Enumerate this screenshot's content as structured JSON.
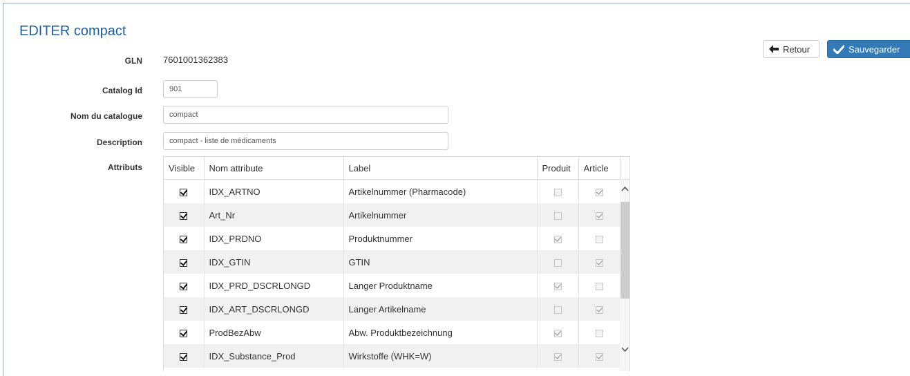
{
  "page": {
    "title": "EDITER compact"
  },
  "buttons": {
    "retour": "Retour",
    "sauvegarder": "Sauvegarder"
  },
  "form": {
    "gln_label": "GLN",
    "gln_value": "7601001362383",
    "catalog_id_label": "Catalog Id",
    "catalog_id_value": "901",
    "catalog_name_label": "Nom du catalogue",
    "catalog_name_value": "compact",
    "description_label": "Description",
    "description_value": "compact - liste de médicaments",
    "attributes_label": "Attributs"
  },
  "table": {
    "columns": [
      "Visible",
      "Nom attribute",
      "Label",
      "Produit",
      "Article"
    ],
    "rows": [
      {
        "visible": true,
        "name": "IDX_ARTNO",
        "label": "Artikelnummer (Pharmacode)",
        "produit": false,
        "article": true
      },
      {
        "visible": true,
        "name": "Art_Nr",
        "label": "Artikelnummer",
        "produit": false,
        "article": true
      },
      {
        "visible": true,
        "name": "IDX_PRDNO",
        "label": "Produktnummer",
        "produit": true,
        "article": false
      },
      {
        "visible": true,
        "name": "IDX_GTIN",
        "label": "GTIN",
        "produit": false,
        "article": true
      },
      {
        "visible": true,
        "name": "IDX_PRD_DSCRLONGD",
        "label": "Langer Produktname",
        "produit": true,
        "article": false
      },
      {
        "visible": true,
        "name": "IDX_ART_DSCRLONGD",
        "label": "Langer Artikelname",
        "produit": false,
        "article": true
      },
      {
        "visible": true,
        "name": "ProdBezAbw",
        "label": "Abw. Produktbezeichnung",
        "produit": true,
        "article": false
      },
      {
        "visible": true,
        "name": "IDX_Substance_Prod",
        "label": "Wirkstoffe (WHK=W)",
        "produit": true,
        "article": true
      }
    ]
  }
}
